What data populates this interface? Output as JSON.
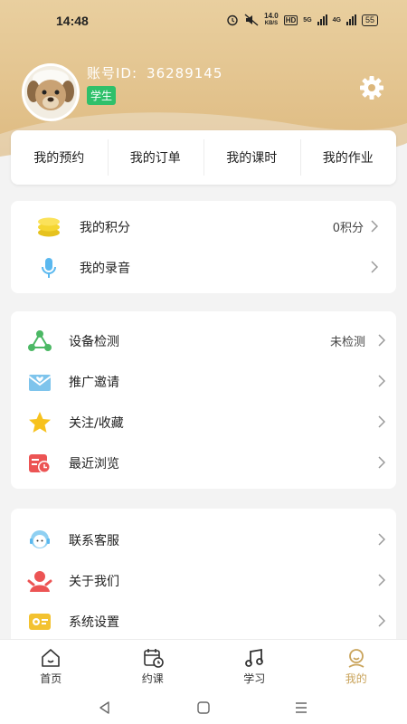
{
  "status_bar": {
    "time": "14:48",
    "speed_top": "14.0",
    "speed_unit": "KB/S",
    "hd": "HD",
    "sig1": "5G",
    "sig2": "4G",
    "battery": "55"
  },
  "profile": {
    "account_label": "账号ID:",
    "account_id": "36289145",
    "role": "学生"
  },
  "quick_links": [
    "我的预约",
    "我的订单",
    "我的课时",
    "我的作业"
  ],
  "group1": {
    "points_label": "我的积分",
    "points_value": "0积分",
    "recording_label": "我的录音"
  },
  "group2": {
    "device_check_label": "设备检测",
    "device_check_value": "未检测",
    "invite_label": "推广邀请",
    "favorites_label": "关注/收藏",
    "recent_label": "最近浏览"
  },
  "group3": {
    "service_label": "联系客服",
    "about_label": "关于我们",
    "settings_label": "系统设置"
  },
  "bottom_nav": {
    "home": "首页",
    "booking": "约课",
    "study": "学习",
    "mine": "我的"
  },
  "colors": {
    "header": "#e2c28c",
    "badge": "#2fc06a",
    "active_tab": "#c9a35a"
  }
}
